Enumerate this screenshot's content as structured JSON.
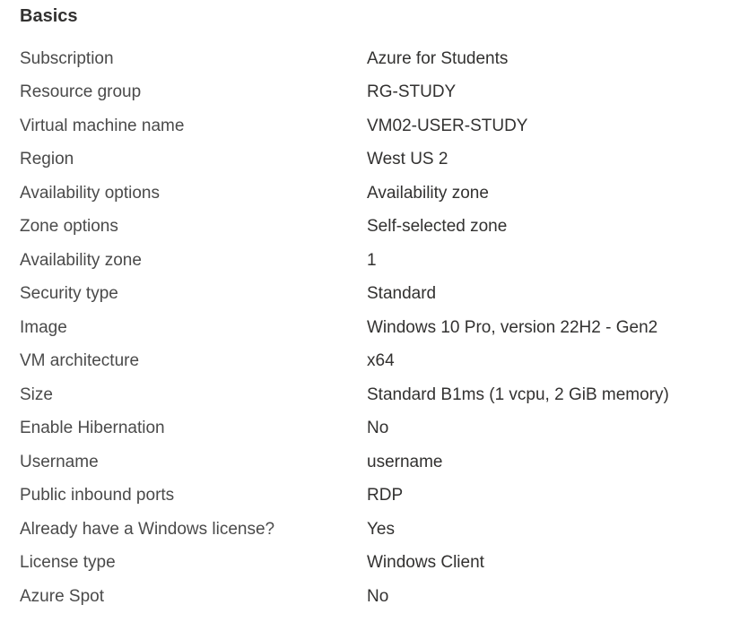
{
  "section": {
    "title": "Basics"
  },
  "rows": [
    {
      "label": "Subscription",
      "value": "Azure for Students"
    },
    {
      "label": "Resource group",
      "value": "RG-STUDY"
    },
    {
      "label": "Virtual machine name",
      "value": "VM02-USER-STUDY"
    },
    {
      "label": "Region",
      "value": "West US 2"
    },
    {
      "label": "Availability options",
      "value": "Availability zone"
    },
    {
      "label": "Zone options",
      "value": "Self-selected zone"
    },
    {
      "label": "Availability zone",
      "value": "1"
    },
    {
      "label": "Security type",
      "value": "Standard"
    },
    {
      "label": "Image",
      "value": "Windows 10 Pro, version 22H2 - Gen2"
    },
    {
      "label": "VM architecture",
      "value": "x64"
    },
    {
      "label": "Size",
      "value": "Standard B1ms (1 vcpu, 2 GiB memory)"
    },
    {
      "label": "Enable Hibernation",
      "value": "No"
    },
    {
      "label": "Username",
      "value": "username"
    },
    {
      "label": "Public inbound ports",
      "value": "RDP"
    },
    {
      "label": "Already have a Windows license?",
      "value": "Yes"
    },
    {
      "label": "License type",
      "value": "Windows Client"
    },
    {
      "label": "Azure Spot",
      "value": "No"
    }
  ]
}
